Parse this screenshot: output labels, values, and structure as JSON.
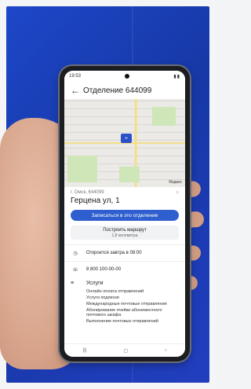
{
  "status": {
    "time": "19:53"
  },
  "header": {
    "title": "Отделение 644099"
  },
  "office": {
    "city_line": "г. Омск, 644099",
    "address": "Герцена ул, 1"
  },
  "actions": {
    "signup_label": "Записаться в это отделение",
    "route_label": "Построить маршрут",
    "route_distance": "1,8 километра"
  },
  "details": {
    "hours_text": "Откроется завтра в 08:00",
    "phone": "8 800 100-00-00"
  },
  "services": {
    "title": "Услуги",
    "items": [
      "Онлайн оплата отправлений",
      "Услуги подписки",
      "Международные почтовые отправления",
      "Абонирование ячейки абонементного почтового шкафа",
      "Выполнение почтовых отправлений"
    ]
  },
  "map": {
    "watermark": "Яндекс"
  },
  "colors": {
    "accent": "#2f5fcf",
    "backdrop": "#1d47c9"
  }
}
